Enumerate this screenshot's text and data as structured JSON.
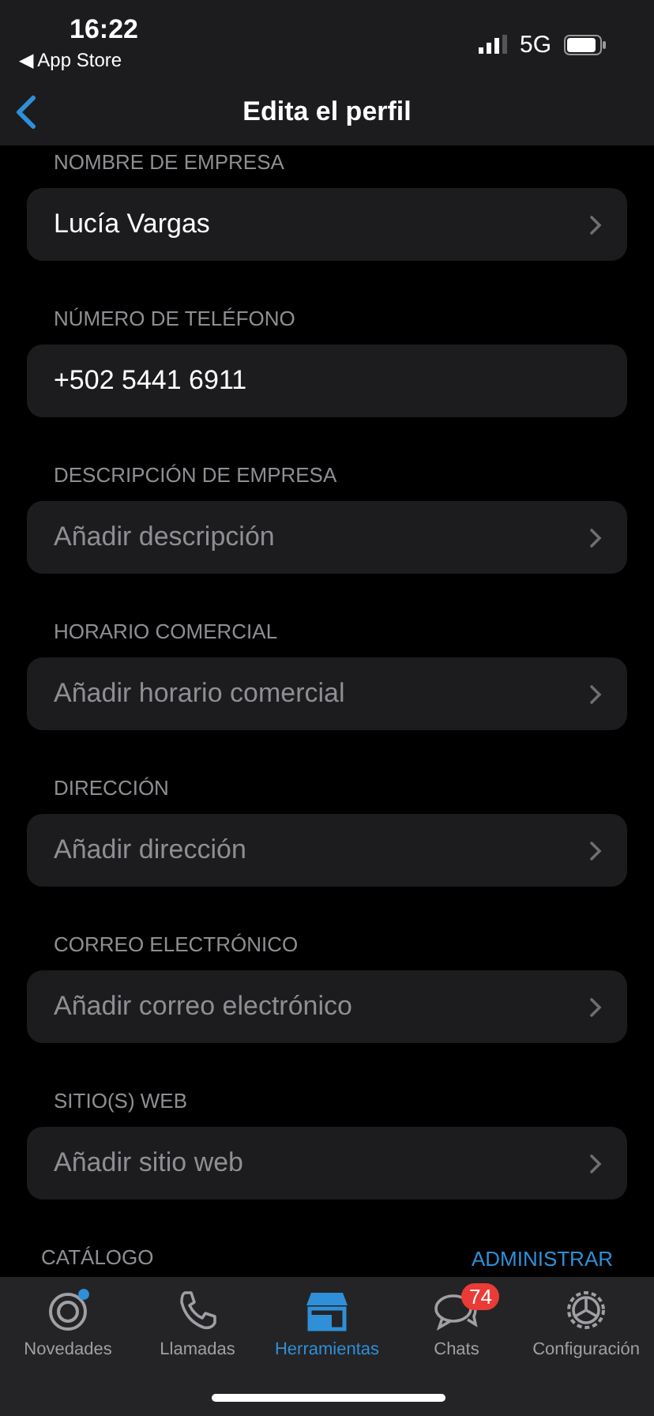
{
  "status_bar": {
    "time": "16:22",
    "back_app": "◀ App Store",
    "network": "5G"
  },
  "nav": {
    "title": "Edita el perfil"
  },
  "sections": [
    {
      "label": "NOMBRE DE EMPRESA",
      "value": "Lucía Vargas",
      "chevron": true
    },
    {
      "label": "NÚMERO DE TELÉFONO",
      "value": "+502 5441 6911",
      "chevron": false
    },
    {
      "label": "DESCRIPCIÓN DE EMPRESA",
      "placeholder": "Añadir descripción",
      "chevron": true
    },
    {
      "label": "HORARIO COMERCIAL",
      "placeholder": "Añadir horario comercial",
      "chevron": true
    },
    {
      "label": "DIRECCIÓN",
      "placeholder": "Añadir dirección",
      "chevron": true
    },
    {
      "label": "CORREO ELECTRÓNICO",
      "placeholder": "Añadir correo electrónico",
      "chevron": true
    },
    {
      "label": "SITIO(S) WEB",
      "placeholder": "Añadir sitio web",
      "chevron": true
    }
  ],
  "catalog": {
    "label": "CATÁLOGO",
    "action": "ADMINISTRAR"
  },
  "tabs": [
    {
      "kind": "updates",
      "label": "Novedades",
      "selected": false,
      "dot": true
    },
    {
      "kind": "calls",
      "label": "Llamadas",
      "selected": false
    },
    {
      "kind": "tools",
      "label": "Herramientas",
      "selected": true
    },
    {
      "kind": "chats",
      "label": "Chats",
      "selected": false,
      "badge": "74"
    },
    {
      "kind": "settings",
      "label": "Configuración",
      "selected": false
    }
  ]
}
